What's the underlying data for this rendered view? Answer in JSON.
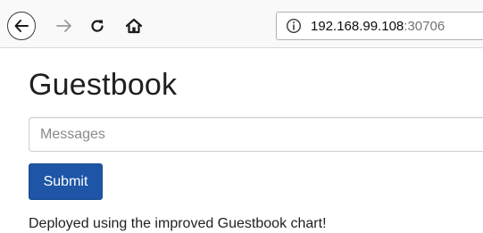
{
  "browser": {
    "url_host": "192.168.99.108",
    "url_port": ":30706",
    "icons": {
      "back": "back-arrow-icon",
      "forward": "forward-arrow-icon",
      "reload": "reload-icon",
      "home": "home-icon",
      "info": "info-icon"
    }
  },
  "page": {
    "title": "Guestbook",
    "message_placeholder": "Messages",
    "submit_label": "Submit",
    "footer": "Deployed using the improved Guestbook chart!"
  },
  "colors": {
    "submit_background": "#1e55a6",
    "toolbar_background": "#f9f9fa"
  }
}
